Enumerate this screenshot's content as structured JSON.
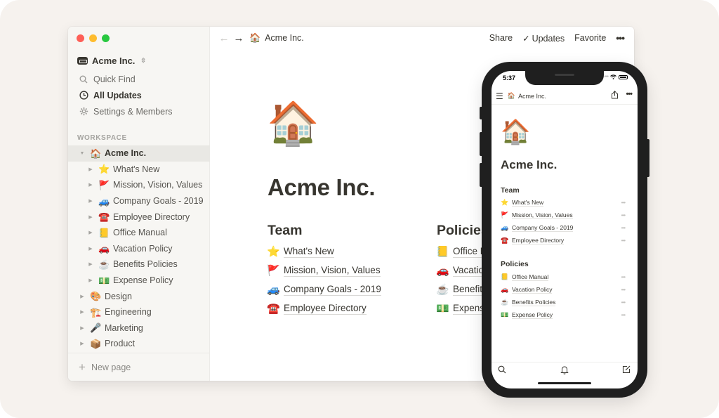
{
  "window": {
    "traffic_lights": [
      "close",
      "minimize",
      "zoom"
    ]
  },
  "sidebar": {
    "workspace_name": "Acme Inc.",
    "workspace_switcher_icon": "chevron-up-down-icon",
    "menu": [
      {
        "label": "Quick Find",
        "icon": "search-icon",
        "active": false
      },
      {
        "label": "All Updates",
        "icon": "clock-icon",
        "active": true
      },
      {
        "label": "Settings & Members",
        "icon": "gear-icon",
        "active": false
      }
    ],
    "section_label": "WORKSPACE",
    "tree": [
      {
        "emoji": "🏠",
        "label": "Acme Inc.",
        "level": 0,
        "expanded": true,
        "selected": true
      },
      {
        "emoji": "⭐",
        "label": "What's New",
        "level": 1
      },
      {
        "emoji": "🚩",
        "label": "Mission, Vision, Values",
        "level": 1
      },
      {
        "emoji": "🚙",
        "label": "Company Goals - 2019",
        "level": 1
      },
      {
        "emoji": "☎️",
        "label": "Employee Directory",
        "level": 1
      },
      {
        "emoji": "📒",
        "label": "Office Manual",
        "level": 1
      },
      {
        "emoji": "🚗",
        "label": "Vacation Policy",
        "level": 1
      },
      {
        "emoji": "☕",
        "label": "Benefits Policies",
        "level": 1
      },
      {
        "emoji": "💵",
        "label": "Expense Policy",
        "level": 1
      },
      {
        "emoji": "🎨",
        "label": "Design",
        "level": 0
      },
      {
        "emoji": "🏗️",
        "label": "Engineering",
        "level": 0
      },
      {
        "emoji": "🎤",
        "label": "Marketing",
        "level": 0
      },
      {
        "emoji": "📦",
        "label": "Product",
        "level": 0
      }
    ],
    "new_page_label": "New page"
  },
  "topbar": {
    "back_icon": "←",
    "forward_icon": "→",
    "breadcrumb_emoji": "🏠",
    "breadcrumb_label": "Acme Inc.",
    "share_label": "Share",
    "updates_label": "Updates",
    "updates_check": "✓",
    "favorite_label": "Favorite",
    "more_icon": "•••"
  },
  "page": {
    "icon": "🏠",
    "title": "Acme Inc.",
    "columns": [
      {
        "heading": "Team",
        "links": [
          {
            "emoji": "⭐",
            "label": "What's New"
          },
          {
            "emoji": "🚩",
            "label": "Mission, Vision, Values"
          },
          {
            "emoji": "🚙",
            "label": "Company Goals - 2019"
          },
          {
            "emoji": "☎️",
            "label": "Employee Directory"
          }
        ]
      },
      {
        "heading": "Policies",
        "links": [
          {
            "emoji": "📒",
            "label": "Office Manual"
          },
          {
            "emoji": "🚗",
            "label": "Vacation Policy"
          },
          {
            "emoji": "☕",
            "label": "Benefits Policies"
          },
          {
            "emoji": "💵",
            "label": "Expense Policy"
          }
        ]
      }
    ]
  },
  "phone": {
    "time": "5:37",
    "menu_icon": "☰",
    "breadcrumb_emoji": "🏠",
    "breadcrumb_label": "Acme Inc.",
    "share_icon": "⍐",
    "more_icon": "•••",
    "page_icon": "🏠",
    "title": "Acme Inc.",
    "sections": [
      {
        "heading": "Team",
        "links": [
          {
            "emoji": "⭐",
            "label": "What's New"
          },
          {
            "emoji": "🚩",
            "label": "Mission, Vision, Values"
          },
          {
            "emoji": "🚙",
            "label": "Company Goals - 2019"
          },
          {
            "emoji": "☎️",
            "label": "Employee Directory"
          }
        ]
      },
      {
        "heading": "Policies",
        "links": [
          {
            "emoji": "📒",
            "label": "Office Manual"
          },
          {
            "emoji": "🚗",
            "label": "Vacation Policy"
          },
          {
            "emoji": "☕",
            "label": "Benefits Policies"
          },
          {
            "emoji": "💵",
            "label": "Expense Policy"
          }
        ]
      }
    ],
    "row_more": "•••",
    "tabs": [
      {
        "name": "search",
        "icon": "search-icon"
      },
      {
        "name": "notifications",
        "icon": "bell-icon"
      },
      {
        "name": "new-page",
        "icon": "compose-icon"
      }
    ]
  }
}
